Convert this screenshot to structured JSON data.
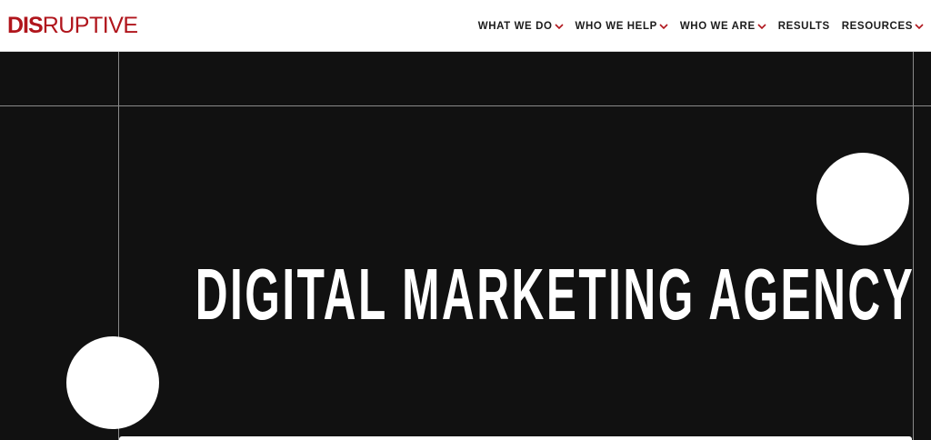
{
  "logo": {
    "part1": "DIS",
    "part2": "RUPTIVE"
  },
  "nav": {
    "items": [
      {
        "label": "WHAT WE DO",
        "dropdown": true,
        "name": "nav-what-we-do"
      },
      {
        "label": "WHO WE HELP",
        "dropdown": true,
        "name": "nav-who-we-help"
      },
      {
        "label": "WHO WE ARE",
        "dropdown": true,
        "name": "nav-who-we-are"
      },
      {
        "label": "RESULTS",
        "dropdown": false,
        "name": "nav-results"
      },
      {
        "label": "RESOURCES",
        "dropdown": true,
        "name": "nav-resources"
      }
    ]
  },
  "hero": {
    "headline": "DIGITAL MARKETING AGENCY"
  },
  "colors": {
    "brand": "#b0151c",
    "hero_bg": "#111111",
    "nav_text": "#1b1b1b"
  }
}
